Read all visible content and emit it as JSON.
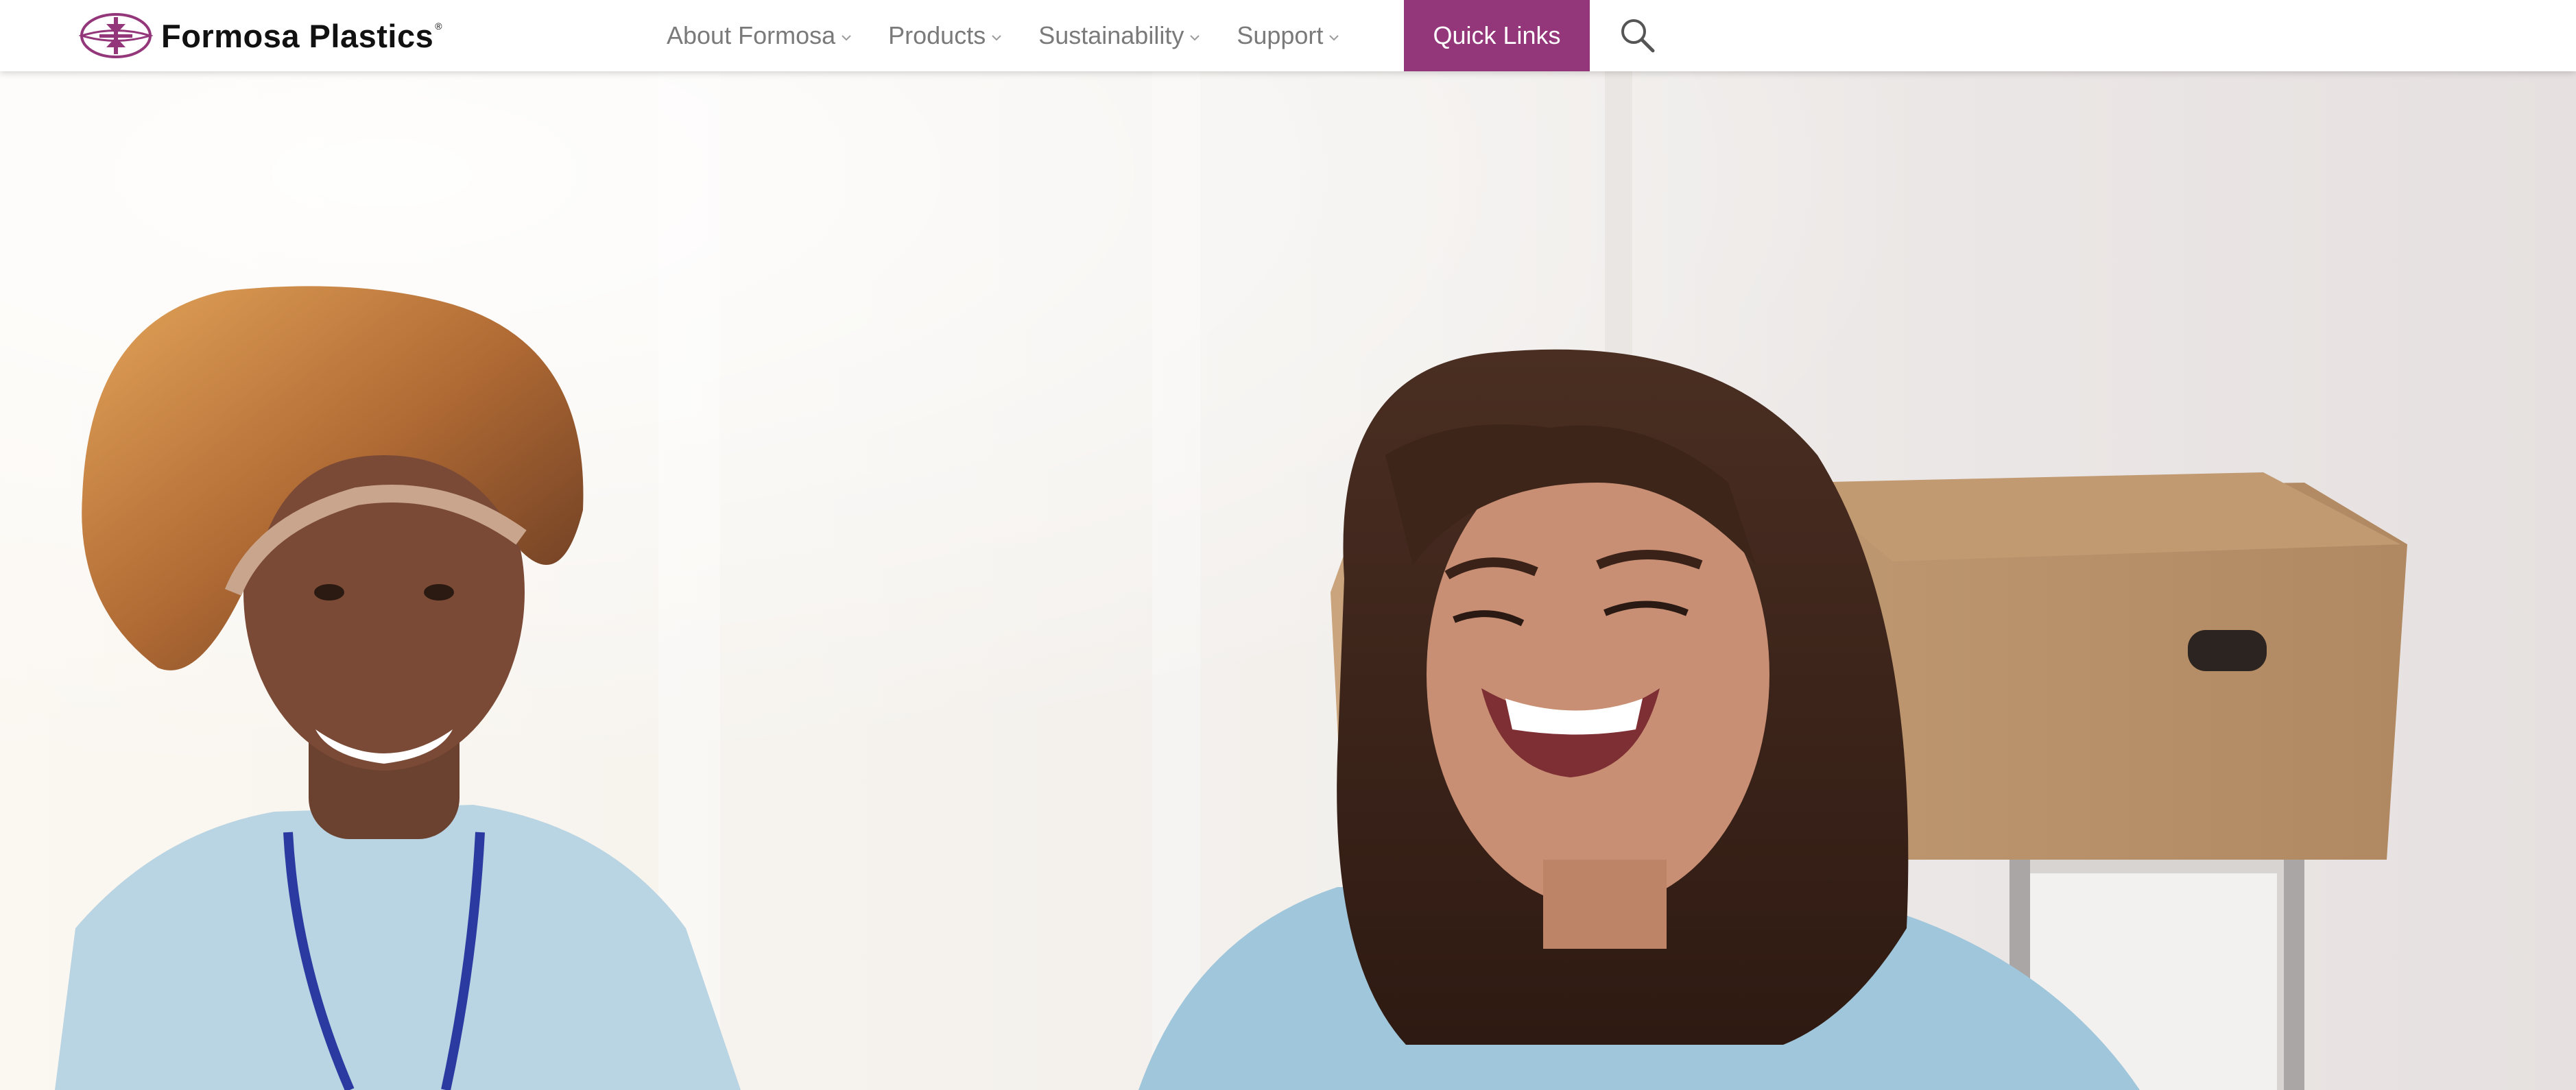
{
  "header": {
    "logo": {
      "text": "Formosa Plastics",
      "registered": "®",
      "icon": "formosa-logo-icon"
    },
    "nav": {
      "items": [
        {
          "label": "About Formosa",
          "icon": "chevron-down-icon"
        },
        {
          "label": "Products",
          "icon": "chevron-down-icon"
        },
        {
          "label": "Sustainability",
          "icon": "chevron-down-icon"
        },
        {
          "label": "Support",
          "icon": "chevron-down-icon"
        }
      ]
    },
    "quick_links_label": "Quick Links",
    "search_icon": "search-icon"
  },
  "colors": {
    "brand": "#93377a",
    "nav_text": "#7a7a7a",
    "logo_text": "#111111",
    "header_bg": "#ffffff"
  },
  "hero": {
    "image": "hero-photo"
  }
}
